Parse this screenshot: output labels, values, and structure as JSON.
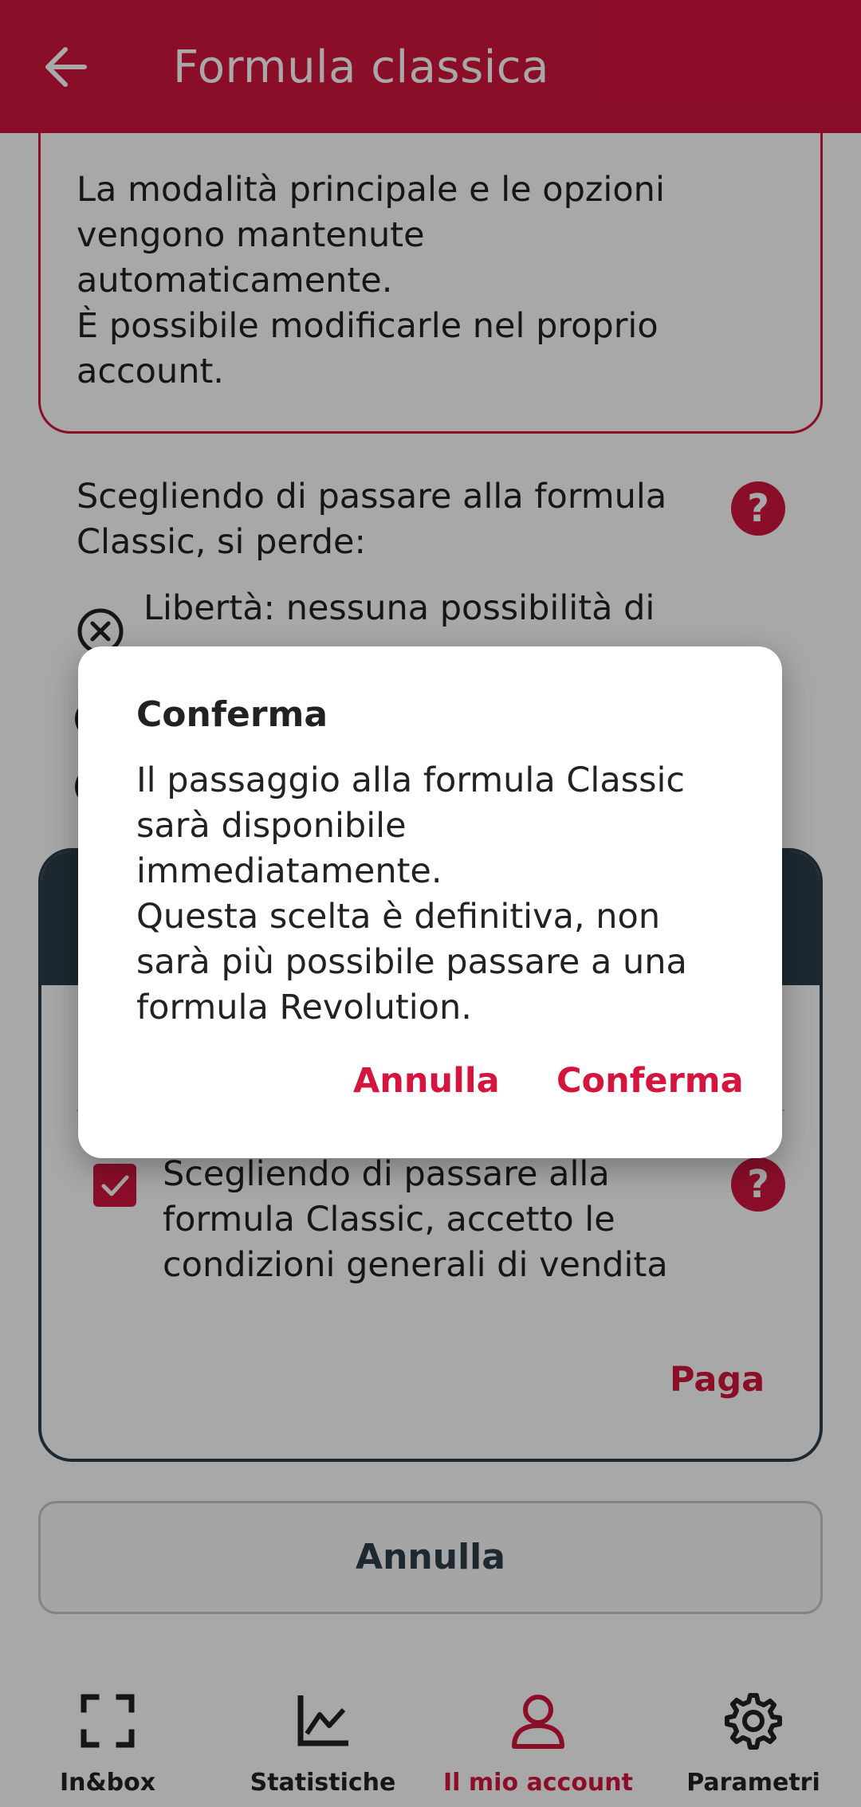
{
  "header": {
    "title": "Formula classica"
  },
  "info_box": {
    "text": "La modalità principale e le opzioni\nvengono mantenute\nautomaticamente.\nÈ possibile modificarle nel proprio\naccount."
  },
  "lose_section": {
    "text": "Scegliendo di passare alla formula\nClassic, si perde:",
    "first_item": "Libertà: nessuna possibilità di"
  },
  "card": {
    "accept_text": "Scegliendo di passare alla\nformula Classic, accetto le\ncondizioni generali di vendita",
    "checkbox_checked": true,
    "pay_label": "Paga"
  },
  "cancel_button": {
    "label": "Annulla"
  },
  "bottom_nav": {
    "items": [
      {
        "label": "In&box",
        "icon": "frame-corners-icon",
        "active": false
      },
      {
        "label": "Statistiche",
        "icon": "chart-line-icon",
        "active": false
      },
      {
        "label": "Il mio account",
        "icon": "user-icon",
        "active": true
      },
      {
        "label": "Parametri",
        "icon": "gear-icon",
        "active": false
      }
    ]
  },
  "dialog": {
    "title": "Conferma",
    "body": "Il passaggio alla formula Classic\nsarà disponibile\nimmediatamente.\nQuesta scelta è definitiva, non\nsarà più possibile passare a una\nformula Revolution.",
    "cancel_label": "Annulla",
    "confirm_label": "Conferma"
  },
  "colors": {
    "primary": "#d4163f",
    "dark": "#2d3e4a"
  }
}
